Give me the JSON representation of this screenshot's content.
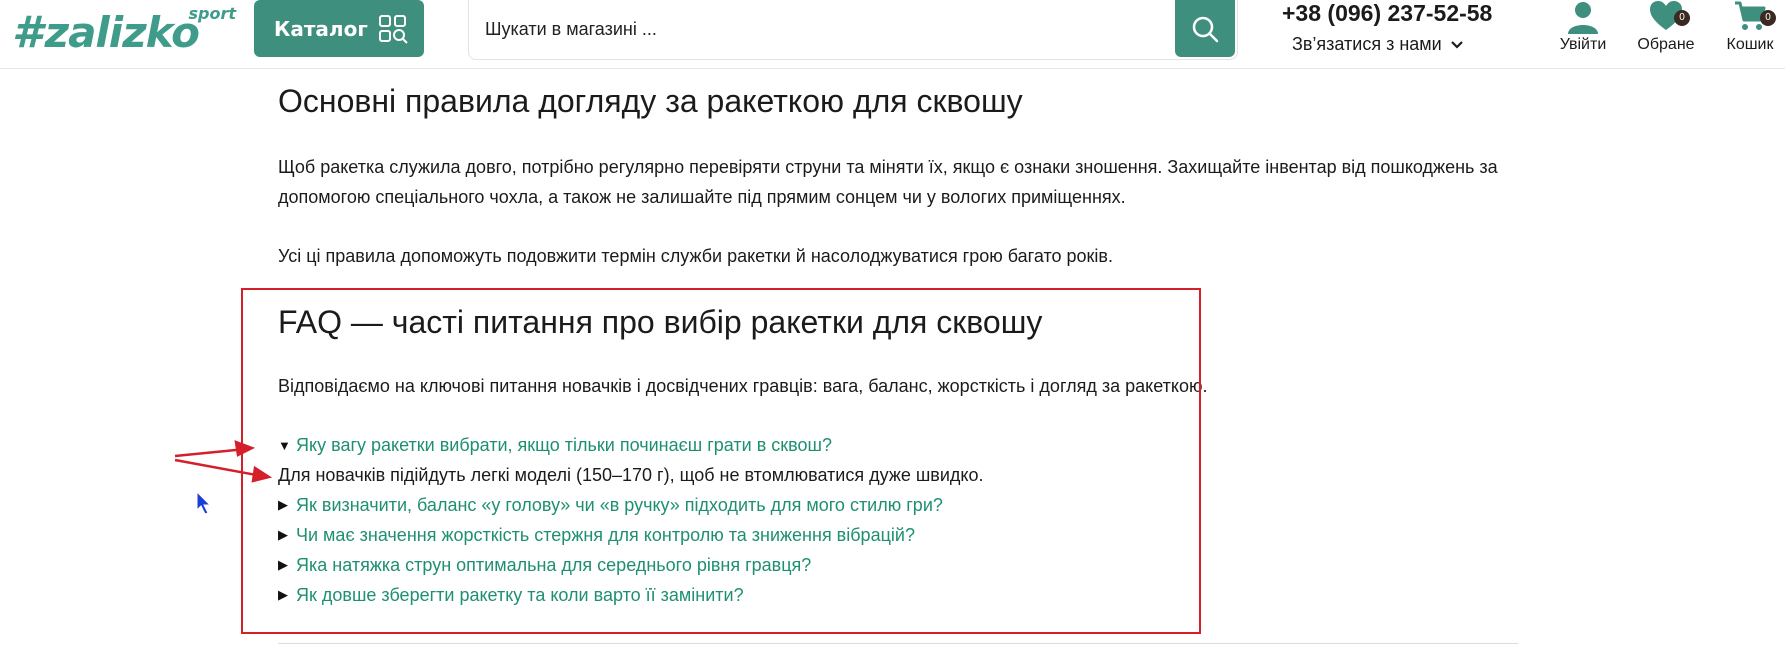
{
  "header": {
    "logo_text": "zalizko",
    "logo_mark": "#",
    "logo_tag": "sport",
    "catalog_label": "Каталог",
    "search_placeholder": "Шукати в магазині ...",
    "phone": "+38 (096) 237-52-58",
    "contact_label": "Зв’язатися з нами",
    "login_label": "Увійти",
    "favorites_label": "Обране",
    "favorites_count": "0",
    "cart_label": "Кошик",
    "cart_count": "0",
    "accent_color": "#3f8f7f"
  },
  "article": {
    "care_heading": "Основні правила догляду за ракеткою для сквошу",
    "care_text": "Щоб ракетка служила довго, потрібно регулярно перевіряти струни та міняти їх, якщо є ознаки зношення. Захищайте інвентар від пошкоджень за допомогою спеціального чохла, а також не залишайте під прямим сонцем чи у вологих приміщеннях.",
    "rules_text": "Усі ці правила допоможуть подовжити термін служби ракетки й насолоджуватися грою багато років.",
    "faq_heading": "FAQ — часті питання про вибір ракетки для сквошу",
    "faq_intro": "Відповідаємо на ключові питання новачків і досвідчених гравців: вага, баланс, жорсткість і догляд за ракеткою.",
    "faq": [
      {
        "question": "Яку вагу ракетки вибрати, якщо тільки починаєш грати в сквош?",
        "expanded": true,
        "answer": "Для новачків підійдуть легкі моделі (150–170 г), щоб не втомлюватися дуже швидко."
      },
      {
        "question": "Як визначити, баланс «у голову» чи «в ручку» підходить для мого стилю гри?",
        "expanded": false
      },
      {
        "question": "Чи має значення жорсткість стержня для контролю та зниження вібрацій?",
        "expanded": false
      },
      {
        "question": "Яка натяжка струн оптимальна для середнього рівня гравця?",
        "expanded": false
      },
      {
        "question": "Як довше зберегти ракетку та коли варто її замінити?",
        "expanded": false
      }
    ],
    "link_color": "#1f8f72",
    "expanded_marker": "▼",
    "collapsed_marker": "▶"
  },
  "annotation": {
    "box_color": "#d4202a"
  }
}
